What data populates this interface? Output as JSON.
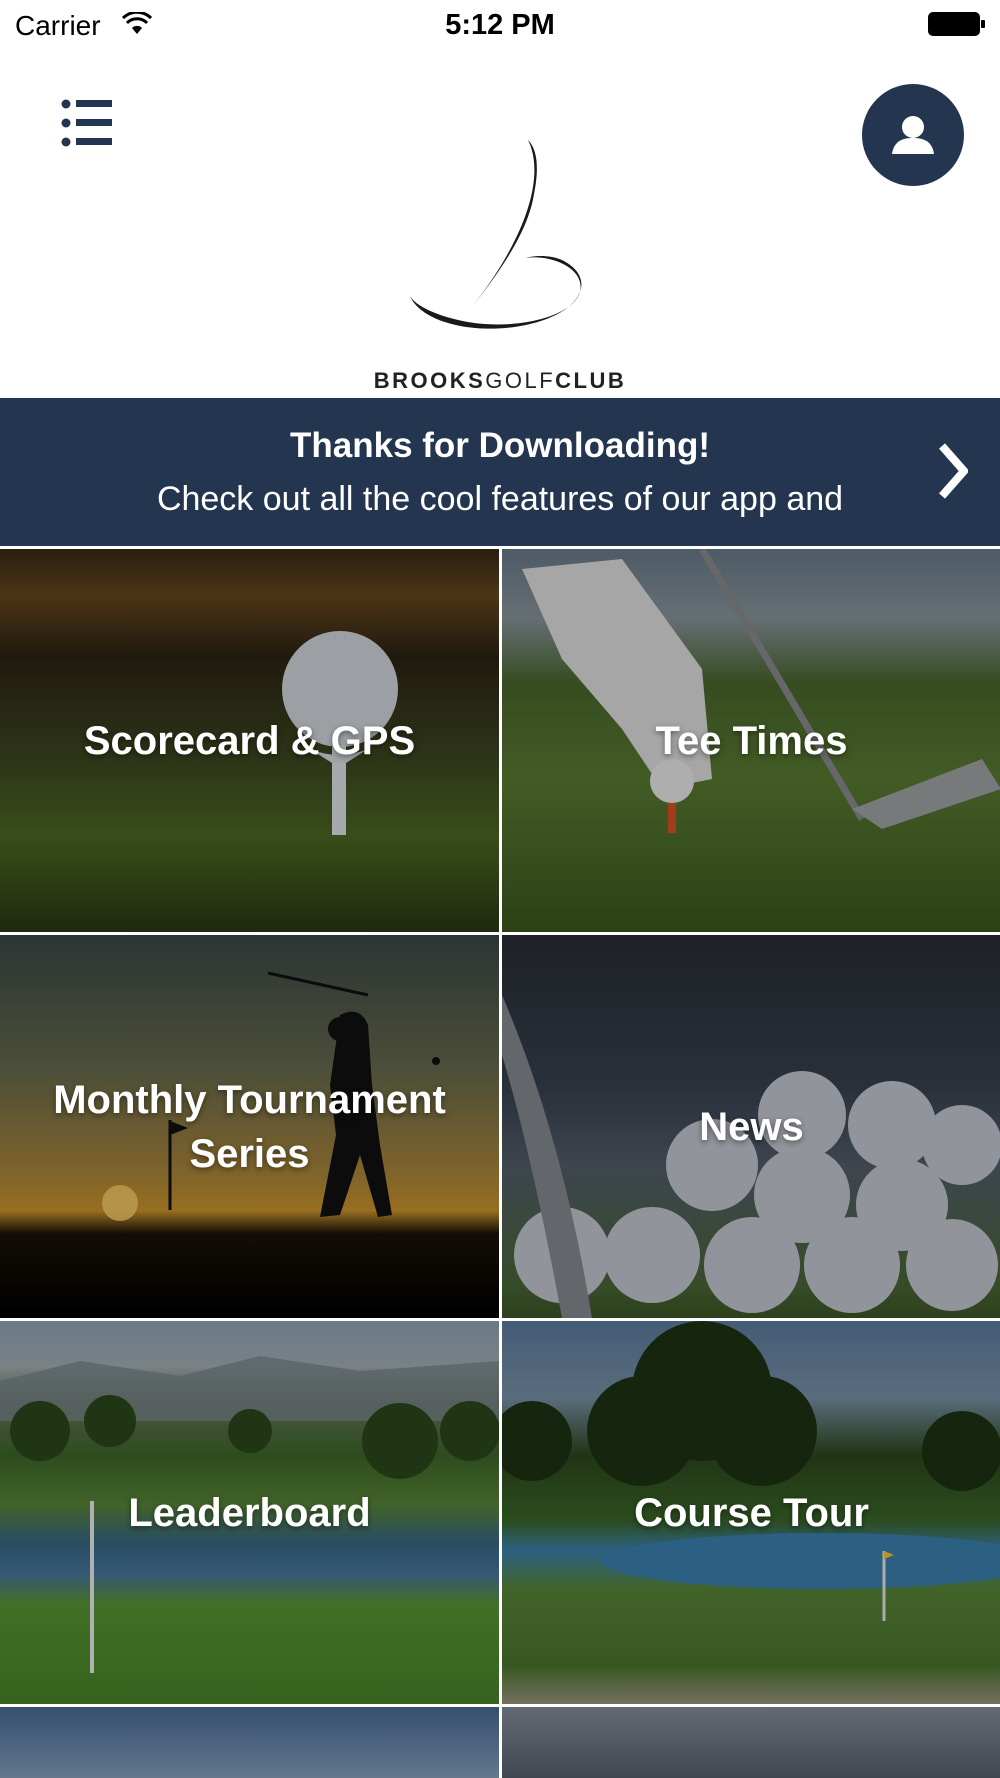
{
  "status_bar": {
    "carrier": "Carrier",
    "time": "5:12 PM"
  },
  "header": {
    "logo_text_bold_1": "BROOKS",
    "logo_text_light": "GOLF",
    "logo_text_bold_2": "CLUB"
  },
  "banner": {
    "title": "Thanks for Downloading!",
    "subtitle": "Check out all the cool features of our app and"
  },
  "tiles": [
    {
      "label": "Scorecard & GPS"
    },
    {
      "label": "Tee Times"
    },
    {
      "label": "Monthly Tournament Series"
    },
    {
      "label": "News"
    },
    {
      "label": "Leaderboard"
    },
    {
      "label": "Course Tour"
    }
  ],
  "colors": {
    "navy": "#24354f",
    "white": "#ffffff"
  },
  "icons": {
    "menu": "list-icon",
    "profile": "user-icon",
    "banner_arrow": "chevron-right-icon"
  }
}
